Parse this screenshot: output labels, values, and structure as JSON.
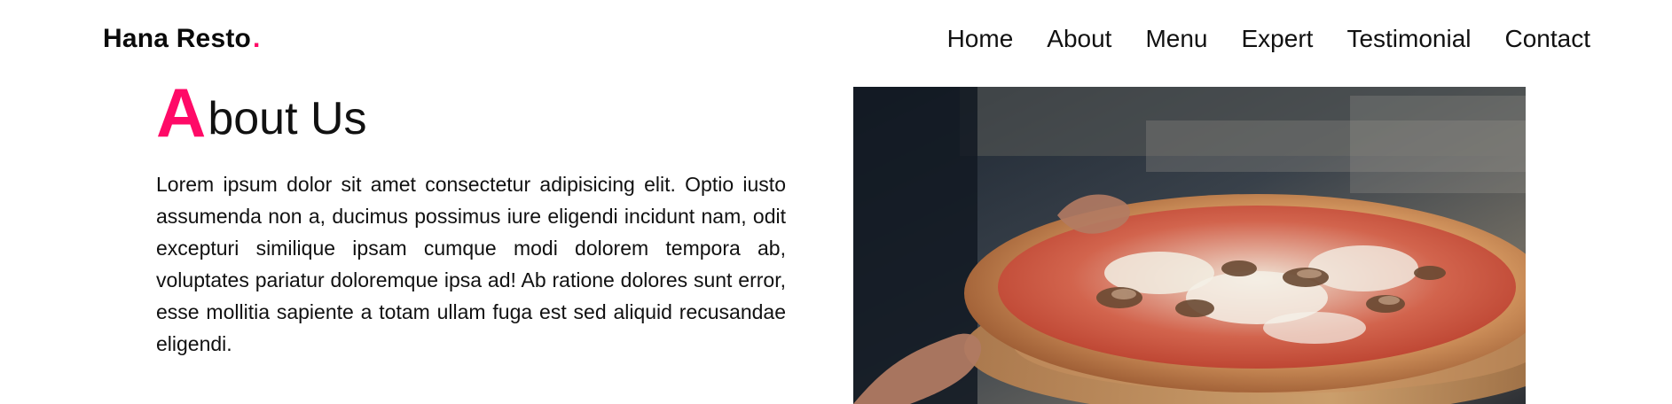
{
  "brand": {
    "name": "Hana Resto",
    "dot": ".",
    "accent_color": "#ff0a67"
  },
  "nav": {
    "items": [
      {
        "label": "Home"
      },
      {
        "label": "About"
      },
      {
        "label": "Menu"
      },
      {
        "label": "Expert"
      },
      {
        "label": "Testimonial"
      },
      {
        "label": "Contact"
      }
    ]
  },
  "about": {
    "title_initial": "A",
    "title_rest": "bout Us",
    "body": "Lorem ipsum dolor sit amet consectetur adipisicing elit. Optio iusto assumenda non a, ducimus possimus iure eligendi incidunt nam, odit excepturi similique ipsam cumque modi dolorem tempora ab, voluptates pariatur doloremque ipsa ad! Ab ratione dolores sunt error, esse mollitia sapiente a totam ullam fuga est sed aliquid recusandae eligendi."
  },
  "image": {
    "subject": "pizza"
  }
}
